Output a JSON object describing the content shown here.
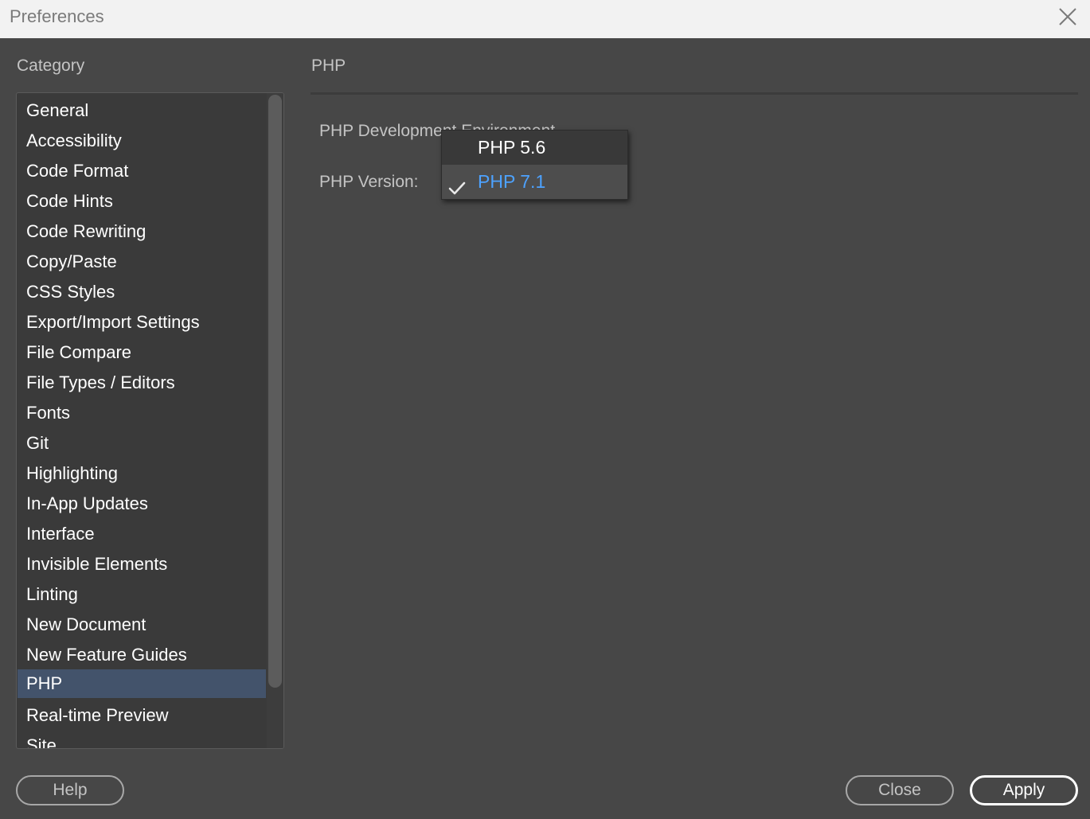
{
  "window": {
    "title": "Preferences"
  },
  "category": {
    "header": "Category",
    "items": [
      {
        "label": "General"
      },
      {
        "label": "Accessibility"
      },
      {
        "label": "Code Format"
      },
      {
        "label": "Code Hints"
      },
      {
        "label": "Code Rewriting"
      },
      {
        "label": "Copy/Paste"
      },
      {
        "label": "CSS Styles"
      },
      {
        "label": "Export/Import Settings"
      },
      {
        "label": "File Compare"
      },
      {
        "label": "File Types / Editors"
      },
      {
        "label": "Fonts"
      },
      {
        "label": "Git"
      },
      {
        "label": "Highlighting"
      },
      {
        "label": "In-App Updates"
      },
      {
        "label": "Interface"
      },
      {
        "label": "Invisible Elements"
      },
      {
        "label": "Linting"
      },
      {
        "label": "New Document"
      },
      {
        "label": "New Feature Guides"
      },
      {
        "label": "PHP"
      },
      {
        "label": "Real-time Preview"
      },
      {
        "label": "Site"
      }
    ],
    "selected": "PHP"
  },
  "panel": {
    "title": "PHP",
    "section_label": "PHP Development Environment",
    "version_label": "PHP Version:",
    "version_options": [
      "PHP 5.6",
      "PHP 7.1"
    ],
    "selected_version": "PHP 7.1"
  },
  "buttons": {
    "help": "Help",
    "close": "Close",
    "apply": "Apply"
  },
  "colors": {
    "background": "#474747",
    "selection": "#43536b",
    "selected_option_text": "#4da2ff"
  },
  "icons": {
    "window_close": "close-icon",
    "selected_marker": "checkmark-icon"
  }
}
